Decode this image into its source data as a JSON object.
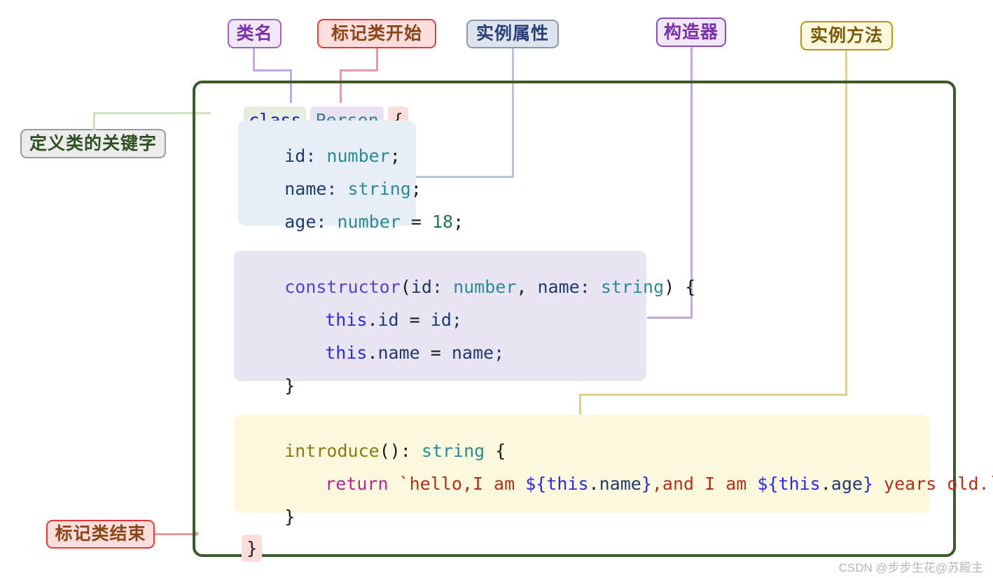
{
  "diagram": {
    "title_watermark": "CSDN @步步生花@苏殿主",
    "labels": {
      "class_name": "类名",
      "class_start": "标记类开始",
      "instance_props": "实例属性",
      "constructor": "构造器",
      "instance_method": "实例方法",
      "class_keyword": "定义类的关键字",
      "class_end": "标记类结束"
    },
    "code": {
      "line_class": {
        "keyword": "class",
        "name": "Person",
        "brace_open": "{"
      },
      "properties": [
        {
          "name": "id:",
          "type": " number",
          "tail": ";"
        },
        {
          "name": "name:",
          "type": " string",
          "tail": ";"
        },
        {
          "name": "age:",
          "type": " number",
          "eq": " = ",
          "value": "18",
          "tail": ";"
        }
      ],
      "constructor": {
        "keyword": "constructor",
        "signature_open": "(",
        "param1_name": "id: ",
        "param1_type": "number",
        "param_sep": ", ",
        "param2_name": "name: ",
        "param2_type": "string",
        "signature_close": ") {",
        "body": [
          {
            "this": "this",
            "dot": ".",
            "prop": "id",
            "assign": " = ",
            "value": "id;"
          },
          {
            "this": "this",
            "dot": ".",
            "prop": "name",
            "assign": " = ",
            "value": "name;"
          }
        ],
        "brace_close": "}"
      },
      "method": {
        "name": "introduce",
        "parens": "(): ",
        "return_type": "string",
        "brace_open": " {",
        "return_keyword": "return",
        "string_part1": " `hello,I am ",
        "interp1_open": "${",
        "interp1_this": "this",
        "interp1_dot": ".",
        "interp1_prop": "name",
        "interp1_close": "}",
        "string_part2": ",and I am ",
        "interp2_open": "${",
        "interp2_this": "this",
        "interp2_dot": ".",
        "interp2_prop": "age",
        "interp2_close": "}",
        "string_part3": " years old.`",
        "brace_close": "}"
      },
      "class_close_brace": "}"
    },
    "colors": {
      "frame_border": "#3a5a28",
      "props_panel": "#e7eef5",
      "ctor_panel": "#e9e4f1",
      "method_panel": "#fbf8dd",
      "connector_classname": "#c3a8dd",
      "connector_classstart": "#e39ca0",
      "connector_props": "#b4c6dc",
      "connector_ctor": "#c3a8dd",
      "connector_method": "#e0cf8e",
      "connector_keyword": "#cfe0c2"
    }
  }
}
